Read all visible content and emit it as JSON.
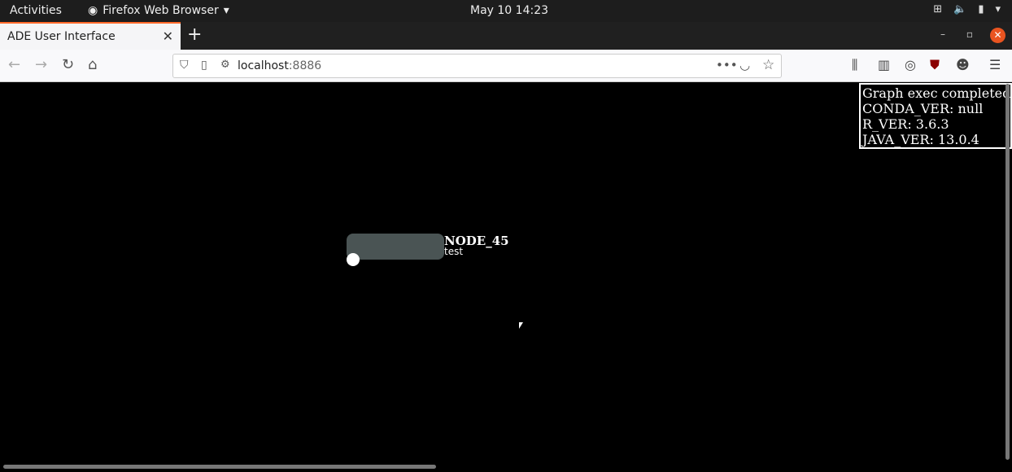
{
  "system": {
    "activities": "Activities",
    "app_name": "Firefox Web Browser",
    "clock": "May 10  14:23"
  },
  "browser": {
    "tab_title": "ADE User Interface",
    "url_host": "localhost",
    "url_port": ":8886"
  },
  "page": {
    "info_lines": [
      "Graph exec completed",
      "CONDA_VER: null",
      "R_VER: 3.6.3",
      "JAVA_VER: 13.0.4"
    ],
    "node": {
      "name": "NODE_45",
      "subtitle": "test",
      "color": "#4a5454"
    }
  },
  "colors": {
    "tab_accent": "#ff6a2b",
    "window_close": "#e95420",
    "canvas_bg": "#000000"
  }
}
